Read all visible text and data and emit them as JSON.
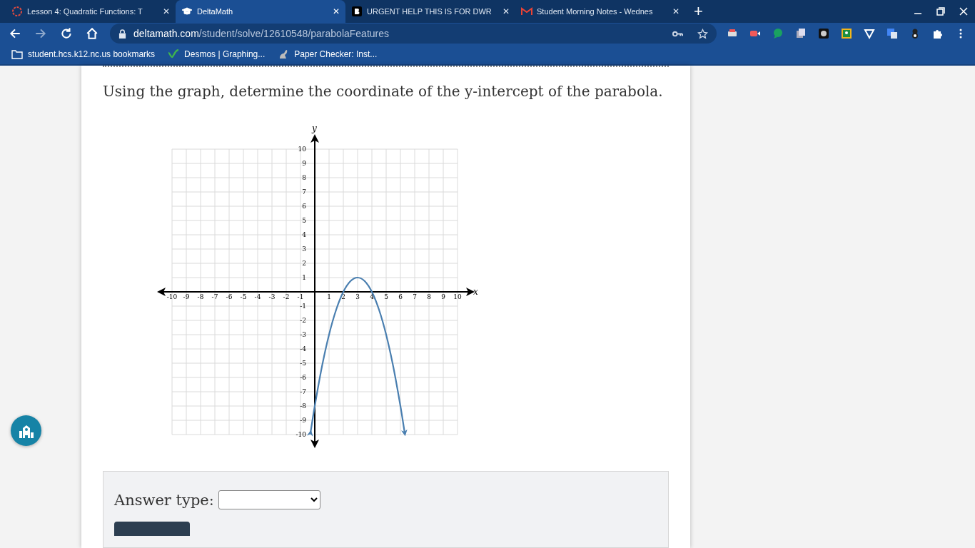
{
  "browser": {
    "tabs": [
      {
        "title": "Lesson 4: Quadratic Functions: T",
        "close": "✕",
        "selected": false
      },
      {
        "title": "DeltaMath",
        "close": "✕",
        "selected": true
      },
      {
        "title": "URGENT HELP THIS IS FOR DWR",
        "close": "✕",
        "selected": false
      },
      {
        "title": "Student Morning Notes - Wednes",
        "close": "✕",
        "selected": false
      }
    ],
    "new_tab": "+",
    "url_domain": "deltamath.com",
    "url_path": "/student/solve/12610548/parabolaFeatures",
    "bookmarks": [
      {
        "label": "student.hcs.k12.nc.us bookmarks"
      },
      {
        "label": "Desmos | Graphing..."
      },
      {
        "label": "Paper Checker: Inst..."
      }
    ]
  },
  "question": "Using the graph, determine the coordinate of the y-intercept of the parabola.",
  "chart_data": {
    "type": "line",
    "grid": true,
    "xlabel": "x",
    "ylabel": "y",
    "xlim": [
      -10,
      10
    ],
    "ylim": [
      -10,
      10
    ],
    "xticks": [
      -10,
      -9,
      -8,
      -7,
      -6,
      -5,
      -4,
      -3,
      -2,
      -1,
      1,
      2,
      3,
      4,
      5,
      6,
      7,
      8,
      9,
      10
    ],
    "yticks": [
      -10,
      -9,
      -8,
      -7,
      -6,
      -5,
      -4,
      -3,
      -2,
      -1,
      1,
      2,
      3,
      4,
      5,
      6,
      7,
      8,
      9,
      10
    ],
    "x": [
      -0.3,
      0,
      0.5,
      1,
      1.5,
      2,
      2.5,
      3,
      3.5,
      4,
      4.5,
      5,
      5.5,
      6,
      6.3
    ],
    "series": [
      {
        "color": "#4a7fb0",
        "values": [
          -9.89,
          -8,
          -5.25,
          -3,
          -1.25,
          0,
          0.75,
          1,
          0.75,
          0,
          -1.25,
          -3,
          -5.25,
          -8,
          -9.89
        ]
      }
    ]
  },
  "answer": {
    "label": "Answer type:"
  }
}
